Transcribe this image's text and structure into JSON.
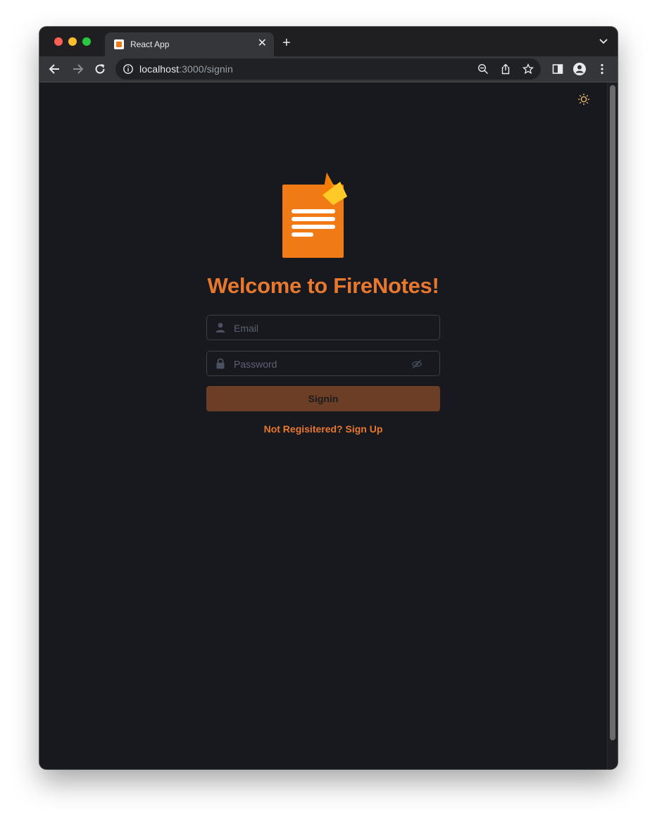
{
  "browser": {
    "tab_title": "React App",
    "url_host": "localhost",
    "url_path": ":3000/signin"
  },
  "page": {
    "title": "Welcome to FireNotes!",
    "email_placeholder": "Email",
    "password_placeholder": "Password",
    "signin_label": "Signin",
    "signup_link": "Not Regisitered? Sign Up"
  },
  "colors": {
    "accent": "#e8782d",
    "background": "#18181f",
    "button": "#6b3e25",
    "logo_body": "#f07b16",
    "flame": "#ffca28"
  },
  "icons": [
    "sun-icon",
    "user-icon",
    "lock-icon",
    "eye-off-icon",
    "back-icon",
    "forward-icon",
    "reload-icon",
    "info-icon",
    "zoom-out-icon",
    "share-icon",
    "star-icon",
    "sidebar-icon",
    "profile-icon",
    "menu-icon"
  ]
}
